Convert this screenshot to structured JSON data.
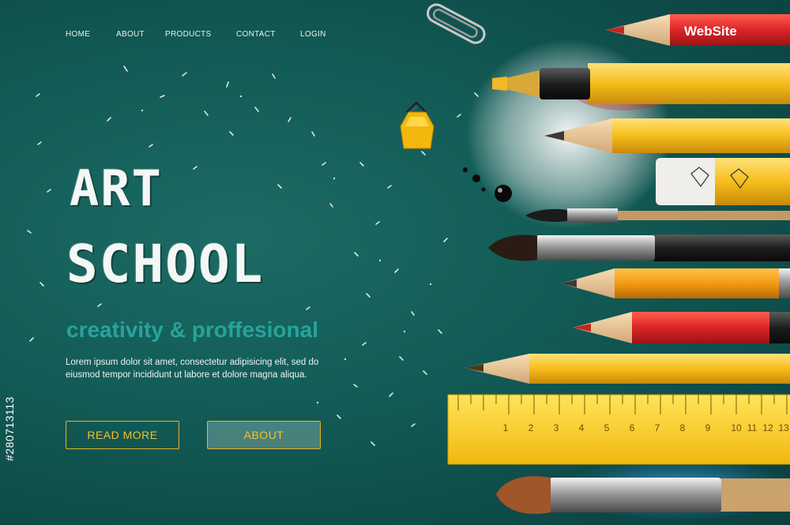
{
  "nav": {
    "items": [
      "HOME",
      "ABOUT",
      "PRODUCTS",
      "CONTACT",
      "LOGIN"
    ]
  },
  "hero": {
    "title_line1": "ART",
    "title_line2": "SCHOOL",
    "tagline": "creativity & proffesional",
    "description": "Lorem ipsum dolor sit amet, consectetur adipisicing elit, sed do eiusmod tempor incididunt ut labore et dolore magna aliqua.",
    "read_more_label": "READ MORE",
    "about_label": "ABOUT"
  },
  "pencil_label": "WebSite",
  "stock_id": "#280713113",
  "ruler_numbers": [
    "1",
    "2",
    "3",
    "4",
    "5",
    "6",
    "7",
    "8",
    "9",
    "10",
    "11",
    "12",
    "13"
  ],
  "colors": {
    "background": "#125a55",
    "accent_teal": "#27a49a",
    "button_border": "#e9b320",
    "pencil_red": "#d8262a",
    "pencil_yellow": "#f2b51a",
    "ruler_yellow": "#f6c816"
  },
  "icons": [
    "paperclip-icon",
    "binder-clip-icon",
    "ink-drops-icon"
  ]
}
